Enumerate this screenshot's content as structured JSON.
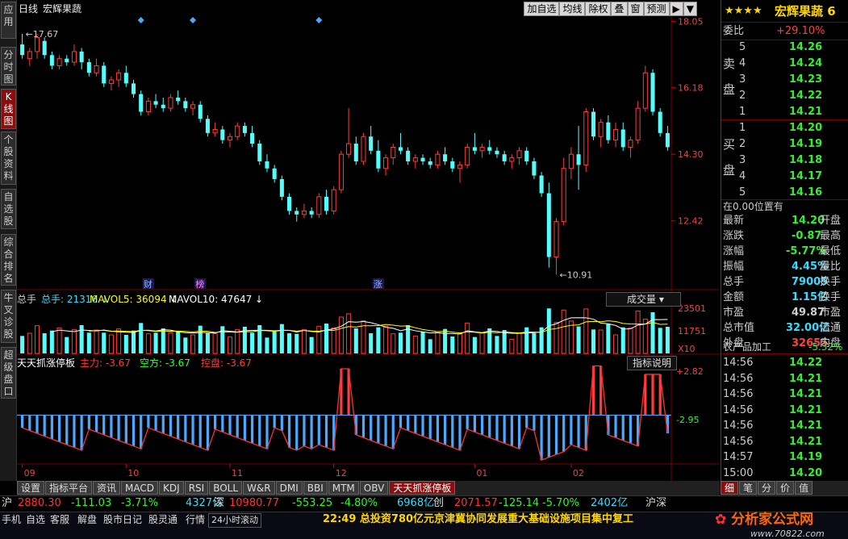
{
  "left_tabs": [
    {
      "label": "应用",
      "top": 2,
      "h": 46,
      "active": false
    },
    {
      "label": "分时图",
      "top": 58,
      "h": 48,
      "active": false
    },
    {
      "label": "K线图",
      "top": 110,
      "h": 50,
      "active": true
    },
    {
      "label": "个股资料",
      "top": 163,
      "h": 66,
      "active": false
    },
    {
      "label": "自选股",
      "top": 234,
      "h": 50,
      "active": false
    },
    {
      "label": "综合排名",
      "top": 290,
      "h": 64,
      "active": false
    },
    {
      "label": "牛叉诊股",
      "top": 359,
      "h": 66,
      "active": false
    },
    {
      "label": "超级盘口",
      "top": 430,
      "h": 64,
      "active": false
    }
  ],
  "header": {
    "period": "日线",
    "stock_name": "宏辉果蔬"
  },
  "toolbar": [
    "加自选",
    "均线",
    "除权",
    "叠",
    "窗",
    "预测",
    "▶",
    "▼"
  ],
  "chart_data": [
    {
      "type": "candlestick",
      "title": "日线 宏辉果蔬",
      "ylim": [
        10.5,
        18.2
      ],
      "yticks": [
        "18.05",
        "16.18",
        "14.30",
        "12.42"
      ],
      "ytick_values": [
        18.05,
        16.18,
        14.3,
        12.42
      ],
      "xticks": [
        "09",
        "10",
        "11",
        "12",
        "01",
        "02"
      ],
      "xtick_pos": [
        0,
        14,
        28,
        42,
        61,
        74
      ],
      "annotations": {
        "high": "17.67",
        "low": "10.91",
        "events": [
          "财",
          "榜",
          "涨"
        ]
      },
      "ohlc": [
        [
          17.4,
          17.7,
          17.0,
          17.1
        ],
        [
          17.0,
          17.3,
          16.8,
          17.2
        ],
        [
          17.2,
          17.7,
          17.0,
          17.6
        ],
        [
          17.5,
          17.6,
          17.0,
          17.1
        ],
        [
          17.1,
          17.2,
          16.7,
          16.8
        ],
        [
          16.8,
          17.1,
          16.7,
          17.0
        ],
        [
          17.0,
          17.1,
          16.8,
          16.9
        ],
        [
          16.9,
          17.4,
          16.8,
          17.2
        ],
        [
          17.2,
          17.3,
          16.7,
          16.9
        ],
        [
          16.9,
          17.0,
          16.5,
          16.6
        ],
        [
          16.6,
          17.0,
          16.5,
          16.8
        ],
        [
          16.8,
          16.9,
          16.2,
          16.3
        ],
        [
          16.3,
          16.5,
          16.1,
          16.4
        ],
        [
          16.4,
          16.7,
          16.2,
          16.6
        ],
        [
          16.6,
          16.8,
          16.2,
          16.3
        ],
        [
          16.3,
          16.4,
          15.9,
          16.0
        ],
        [
          16.0,
          16.1,
          15.4,
          15.5
        ],
        [
          15.5,
          15.9,
          15.4,
          15.8
        ],
        [
          15.8,
          16.0,
          15.6,
          15.7
        ],
        [
          15.7,
          15.9,
          15.5,
          15.6
        ],
        [
          15.6,
          16.0,
          15.5,
          15.9
        ],
        [
          15.9,
          16.1,
          15.7,
          15.8
        ],
        [
          15.8,
          15.9,
          15.5,
          15.6
        ],
        [
          15.6,
          15.8,
          15.4,
          15.7
        ],
        [
          15.7,
          15.8,
          15.2,
          15.3
        ],
        [
          15.3,
          15.4,
          14.8,
          14.9
        ],
        [
          14.9,
          15.2,
          14.8,
          15.0
        ],
        [
          15.0,
          15.1,
          14.6,
          14.7
        ],
        [
          14.7,
          14.9,
          14.5,
          14.8
        ],
        [
          14.8,
          15.2,
          14.7,
          15.1
        ],
        [
          15.1,
          15.2,
          14.8,
          14.9
        ],
        [
          14.9,
          15.1,
          14.5,
          14.6
        ],
        [
          14.6,
          14.7,
          14.0,
          14.1
        ],
        [
          14.1,
          14.3,
          13.8,
          13.9
        ],
        [
          13.9,
          14.0,
          13.5,
          13.6
        ],
        [
          13.6,
          13.7,
          13.0,
          13.1
        ],
        [
          13.1,
          13.2,
          12.6,
          12.7
        ],
        [
          12.7,
          12.8,
          12.4,
          12.6
        ],
        [
          12.6,
          12.9,
          12.5,
          12.7
        ],
        [
          12.7,
          12.8,
          12.5,
          12.6
        ],
        [
          12.6,
          13.2,
          12.5,
          13.1
        ],
        [
          13.1,
          13.3,
          12.6,
          12.7
        ],
        [
          12.7,
          13.4,
          12.6,
          13.3
        ],
        [
          13.3,
          14.4,
          13.2,
          14.3
        ],
        [
          14.3,
          15.6,
          14.2,
          14.6
        ],
        [
          14.6,
          14.8,
          14.0,
          14.1
        ],
        [
          14.1,
          14.9,
          14.0,
          14.8
        ],
        [
          14.8,
          15.1,
          14.3,
          14.4
        ],
        [
          14.4,
          14.7,
          13.8,
          13.9
        ],
        [
          13.9,
          14.3,
          13.7,
          14.2
        ],
        [
          14.2,
          14.6,
          14.0,
          14.5
        ],
        [
          14.5,
          14.9,
          14.3,
          14.4
        ],
        [
          14.4,
          14.5,
          14.0,
          14.1
        ],
        [
          14.1,
          14.3,
          13.9,
          14.2
        ],
        [
          14.2,
          14.3,
          14.0,
          14.1
        ],
        [
          14.1,
          14.2,
          13.9,
          14.0
        ],
        [
          14.0,
          14.4,
          13.9,
          14.3
        ],
        [
          14.3,
          14.5,
          14.0,
          14.1
        ],
        [
          14.1,
          14.2,
          13.8,
          13.9
        ],
        [
          13.9,
          14.1,
          13.5,
          14.0
        ],
        [
          14.0,
          14.6,
          13.9,
          14.5
        ],
        [
          14.5,
          14.9,
          14.3,
          14.4
        ],
        [
          14.4,
          14.6,
          14.2,
          14.5
        ],
        [
          14.5,
          14.7,
          14.3,
          14.4
        ],
        [
          14.4,
          14.5,
          14.2,
          14.3
        ],
        [
          14.3,
          14.4,
          14.0,
          14.1
        ],
        [
          14.1,
          14.3,
          13.9,
          14.2
        ],
        [
          14.2,
          14.5,
          14.0,
          14.4
        ],
        [
          14.4,
          14.5,
          14.0,
          14.1
        ],
        [
          14.1,
          14.2,
          13.6,
          13.7
        ],
        [
          13.7,
          13.8,
          13.1,
          13.2
        ],
        [
          13.2,
          13.5,
          11.1,
          11.4
        ],
        [
          11.4,
          12.5,
          10.9,
          12.4
        ],
        [
          12.4,
          14.2,
          12.3,
          13.9
        ],
        [
          13.9,
          14.5,
          13.6,
          14.3
        ],
        [
          14.3,
          15.1,
          13.3,
          14.0
        ],
        [
          14.0,
          15.6,
          13.8,
          15.5
        ],
        [
          15.5,
          15.6,
          14.7,
          14.8
        ],
        [
          14.8,
          15.3,
          14.5,
          15.2
        ],
        [
          15.2,
          15.4,
          14.6,
          14.7
        ],
        [
          14.7,
          15.2,
          14.5,
          15.0
        ],
        [
          15.0,
          15.2,
          14.4,
          14.5
        ],
        [
          14.5,
          14.8,
          14.2,
          14.7
        ],
        [
          14.7,
          15.8,
          14.6,
          15.6
        ],
        [
          15.6,
          16.8,
          15.5,
          16.6
        ],
        [
          16.6,
          16.7,
          15.4,
          15.5
        ],
        [
          15.5,
          15.6,
          14.8,
          14.9
        ],
        [
          14.9,
          15.1,
          14.4,
          14.5
        ]
      ]
    },
    {
      "type": "bar",
      "title": "总手",
      "series_labels": [
        "总手: 21316",
        "MAVOL5: 36094",
        "MAVOL10: 47647"
      ],
      "yticks": [
        "23501",
        "11751",
        "X10"
      ],
      "ylim": [
        0,
        26000
      ],
      "dropdown": "成交量"
    },
    {
      "type": "bar",
      "title": "天天抓涨停板",
      "series_labels": [
        "主力: -3.67",
        "空方: -3.67",
        "控盘: -3.67"
      ],
      "yticks": [
        "+2.82",
        "-2.95"
      ],
      "ylim": [
        -4.0,
        3.0
      ],
      "button": "指标说明"
    }
  ],
  "sidebar": {
    "title": "宏辉果蔬 6",
    "stars": "★★★★",
    "weibi_label": "委比",
    "weibi_value": "+29.10%",
    "sell_label": [
      "卖",
      "盘"
    ],
    "sell": [
      [
        "5",
        "14.26"
      ],
      [
        "4",
        "14.24"
      ],
      [
        "3",
        "14.23"
      ],
      [
        "2",
        "14.22"
      ],
      [
        "1",
        "14.21"
      ]
    ],
    "buy_label": [
      "买",
      "盘"
    ],
    "buy": [
      [
        "1",
        "14.20"
      ],
      [
        "2",
        "14.19"
      ],
      [
        "3",
        "14.18"
      ],
      [
        "4",
        "14.17"
      ],
      [
        "5",
        "14.16"
      ]
    ],
    "position_info": "在0.00位置有",
    "stats": [
      [
        "最新",
        "14.20",
        "开盘"
      ],
      [
        "涨跌",
        "-0.87",
        "最高"
      ],
      [
        "涨幅",
        "-5.77%",
        "最低"
      ],
      [
        "振幅",
        "4.45%",
        "量比"
      ],
      [
        "总手",
        "79005",
        "换手"
      ],
      [
        "金额",
        "1.15亿",
        "换手"
      ],
      [
        "市盈",
        "49.87",
        "市盈"
      ],
      [
        "总市值",
        "32.00亿",
        "流通"
      ],
      [
        "外盘",
        "32655",
        "内盘"
      ]
    ],
    "sector": "农产品加工",
    "sector_value": "-5.32%",
    "ticks": [
      [
        "14:56",
        "14.22"
      ],
      [
        "14:56",
        "14.21"
      ],
      [
        "14:56",
        "14.21"
      ],
      [
        "14:56",
        "14.21"
      ],
      [
        "14:56",
        "14.21"
      ],
      [
        "14:56",
        "14.21"
      ],
      [
        "14:57",
        "14.19"
      ],
      [
        "15:00",
        "14.20"
      ]
    ]
  },
  "side_tabs": [
    "细",
    "笔",
    "分",
    "价",
    "值"
  ],
  "bottom_tabs": [
    "设置",
    "指标平台",
    "资讯",
    "MACD",
    "KDJ",
    "RSI",
    "BOLL",
    "W&R",
    "DMI",
    "BBI",
    "MTM",
    "OBV",
    "天天抓涨停板"
  ],
  "index_bar": [
    [
      "沪",
      "#ddd"
    ],
    [
      "2880.30",
      "#f33"
    ],
    [
      "-111.03",
      "#2f2"
    ],
    [
      "-3.71%",
      "#2f2"
    ],
    [
      "4327亿",
      "#3df"
    ],
    [
      "深",
      "#ddd"
    ],
    [
      "10980.77",
      "#f33"
    ],
    [
      "-553.25",
      "#2f2"
    ],
    [
      "-4.80%",
      "#2f2"
    ],
    [
      "6968亿",
      "#3df"
    ],
    [
      "创",
      "#ddd"
    ],
    [
      "2071.57",
      "#f33"
    ],
    [
      "-125.14",
      "#2f2"
    ],
    [
      "-5.70%",
      "#2f2"
    ],
    [
      "2402亿",
      "#3df"
    ],
    [
      "沪深",
      "#ddd"
    ]
  ],
  "footer_buttons": [
    "手机",
    "自选",
    "客服",
    "解盘",
    "股市日记",
    "股灵通",
    "行情",
    "24小时滚动"
  ],
  "news": "22:49 总投资780亿元京津冀协同发展重大基础设施项目集中复工",
  "logo": "分析家公式网",
  "logo_url": "www.70822.com"
}
